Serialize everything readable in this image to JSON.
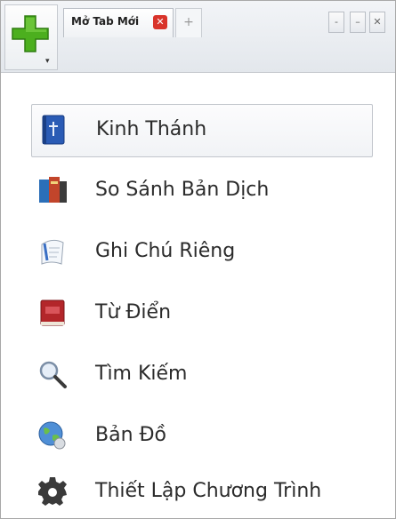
{
  "tabbar": {
    "tab_label": "Mở Tab Mới",
    "close_glyph": "✕",
    "new_tab_glyph": "+",
    "win_buttons": [
      "-",
      "–",
      "✕"
    ]
  },
  "menu": {
    "items": [
      {
        "label": "Kinh Thánh",
        "icon": "bible-icon"
      },
      {
        "label": "So Sánh Bản Dịch",
        "icon": "books-icon"
      },
      {
        "label": "Ghi Chú Riêng",
        "icon": "notes-icon"
      },
      {
        "label": "Từ Điển",
        "icon": "dictionary-icon"
      },
      {
        "label": "Tìm Kiếm",
        "icon": "search-icon"
      },
      {
        "label": "Bản Đồ",
        "icon": "map-globe-icon"
      },
      {
        "label": "Thiết Lập Chương Trình",
        "icon": "gear-icon"
      }
    ]
  },
  "colors": {
    "plus_green": "#4caf1e",
    "close_red": "#d9342b"
  }
}
